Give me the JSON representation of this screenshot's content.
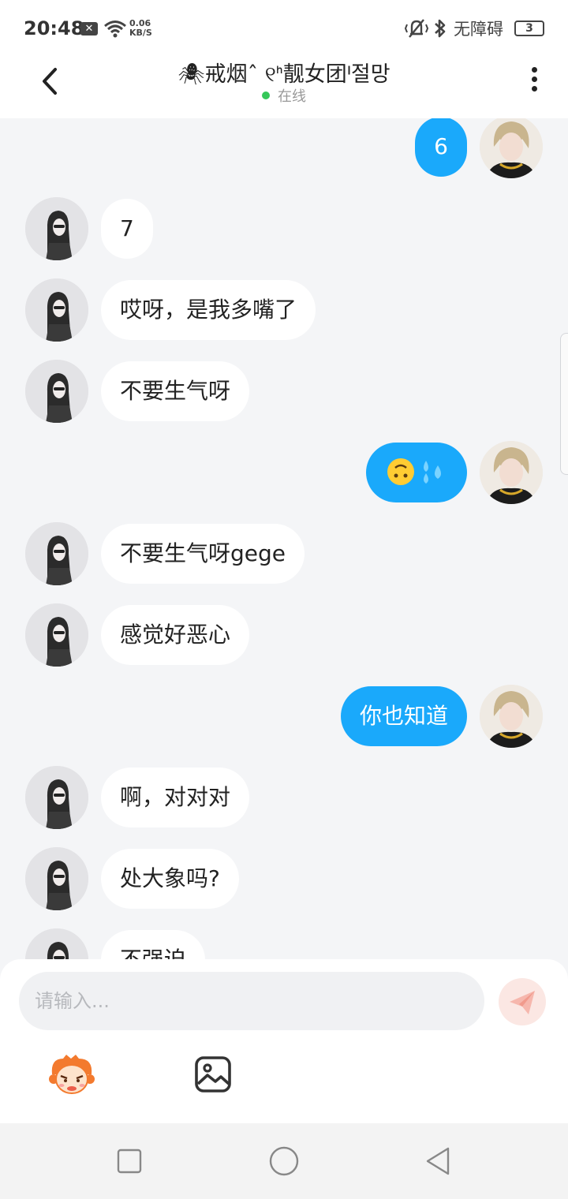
{
  "status_bar": {
    "time": "20:48",
    "notif_icon": "x-icon",
    "net_speed_value": "0.06",
    "net_speed_unit": "KB/S",
    "accessibility_label": "无障碍",
    "battery_level": "3"
  },
  "header": {
    "title": "🕷戒烟ˆ ୧ᑋ靓女团ᑊ절망",
    "status": "在线"
  },
  "messages": [
    {
      "side": "me",
      "text": "6"
    },
    {
      "side": "other",
      "text": "7"
    },
    {
      "side": "other",
      "text": "哎呀，是我多嘴了"
    },
    {
      "side": "other",
      "text": "不要生气呀"
    },
    {
      "side": "me",
      "text": "",
      "emoji": [
        "upside-down-face-emoji",
        "sweat-droplets-emoji"
      ]
    },
    {
      "side": "other",
      "text": "不要生气呀gege"
    },
    {
      "side": "other",
      "text": "感觉好恶心"
    },
    {
      "side": "me",
      "text": "你也知道"
    },
    {
      "side": "other",
      "text": "啊，对对对"
    },
    {
      "side": "other",
      "text": "处大象吗?"
    },
    {
      "side": "other",
      "text": "不强迫"
    }
  ],
  "input": {
    "placeholder": "请输入..."
  },
  "icons": {
    "back": "chevron-left-icon",
    "more": "more-vertical-icon",
    "send": "paper-plane-icon",
    "sticker": "cartoon-face-sticker-icon",
    "image": "image-icon",
    "nav_recents": "square-icon",
    "nav_home": "circle-icon",
    "nav_back": "triangle-back-icon"
  },
  "colors": {
    "my_bubble": "#1aa9fb",
    "their_bubble": "#ffffff",
    "background": "#f4f5f7",
    "online_dot": "#35c759"
  }
}
